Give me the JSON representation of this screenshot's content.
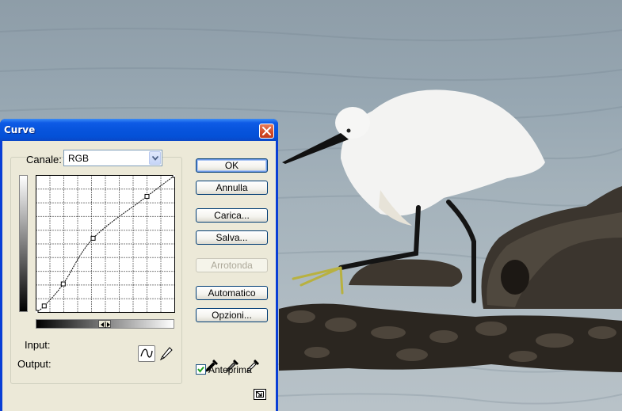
{
  "dialog": {
    "title": "Curve",
    "channel_label": "Canale:",
    "channel_value": "RGB",
    "input_label": "Input:",
    "output_label": "Output:",
    "preview_label": "Anteprima",
    "preview_checked": true
  },
  "buttons": {
    "ok": "OK",
    "cancel": "Annulla",
    "load": "Carica...",
    "save": "Salva...",
    "smooth": "Arrotonda",
    "auto": "Automatico",
    "options": "Opzioni..."
  },
  "curve": {
    "input_range": [
      0,
      255
    ],
    "output_range": [
      0,
      255
    ],
    "points": [
      {
        "input": 0,
        "output": 0
      },
      {
        "input": 15,
        "output": 12
      },
      {
        "input": 50,
        "output": 53
      },
      {
        "input": 105,
        "output": 138
      },
      {
        "input": 204,
        "output": 216
      },
      {
        "input": 255,
        "output": 255
      }
    ]
  },
  "icons": {
    "close": "close-icon",
    "dropdown": "chevron-down-icon",
    "curve_tool": "curve-tool-icon",
    "pencil_tool": "pencil-icon",
    "eyedropper_black": "eyedropper-black-icon",
    "eyedropper_gray": "eyedropper-gray-icon",
    "eyedropper_white": "eyedropper-white-icon",
    "expand": "expand-icon"
  },
  "colors": {
    "title_bar": "#0754dd",
    "dialog_face": "#ece9d8",
    "close_button": "#d24a26"
  }
}
